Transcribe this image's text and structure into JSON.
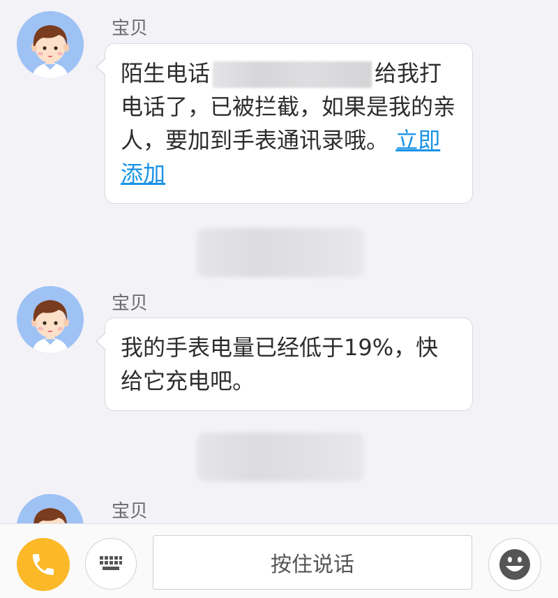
{
  "messages": [
    {
      "sender": "宝贝",
      "text_before_redaction": "陌生电话",
      "text_after_redaction": "给我打电话了，已被拦截，如果是我的亲人，要加到手表通讯录哦。",
      "link_text": "立即添加"
    },
    {
      "sender": "宝贝",
      "text": "我的手表电量已经低于19%，快给它充电吧。"
    },
    {
      "sender": "宝贝"
    }
  ],
  "input_bar": {
    "voice_label": "按住说话",
    "icons": [
      "phone-icon",
      "keyboard-icon",
      "smiley-icon"
    ],
    "call_color": "#fbb928"
  }
}
